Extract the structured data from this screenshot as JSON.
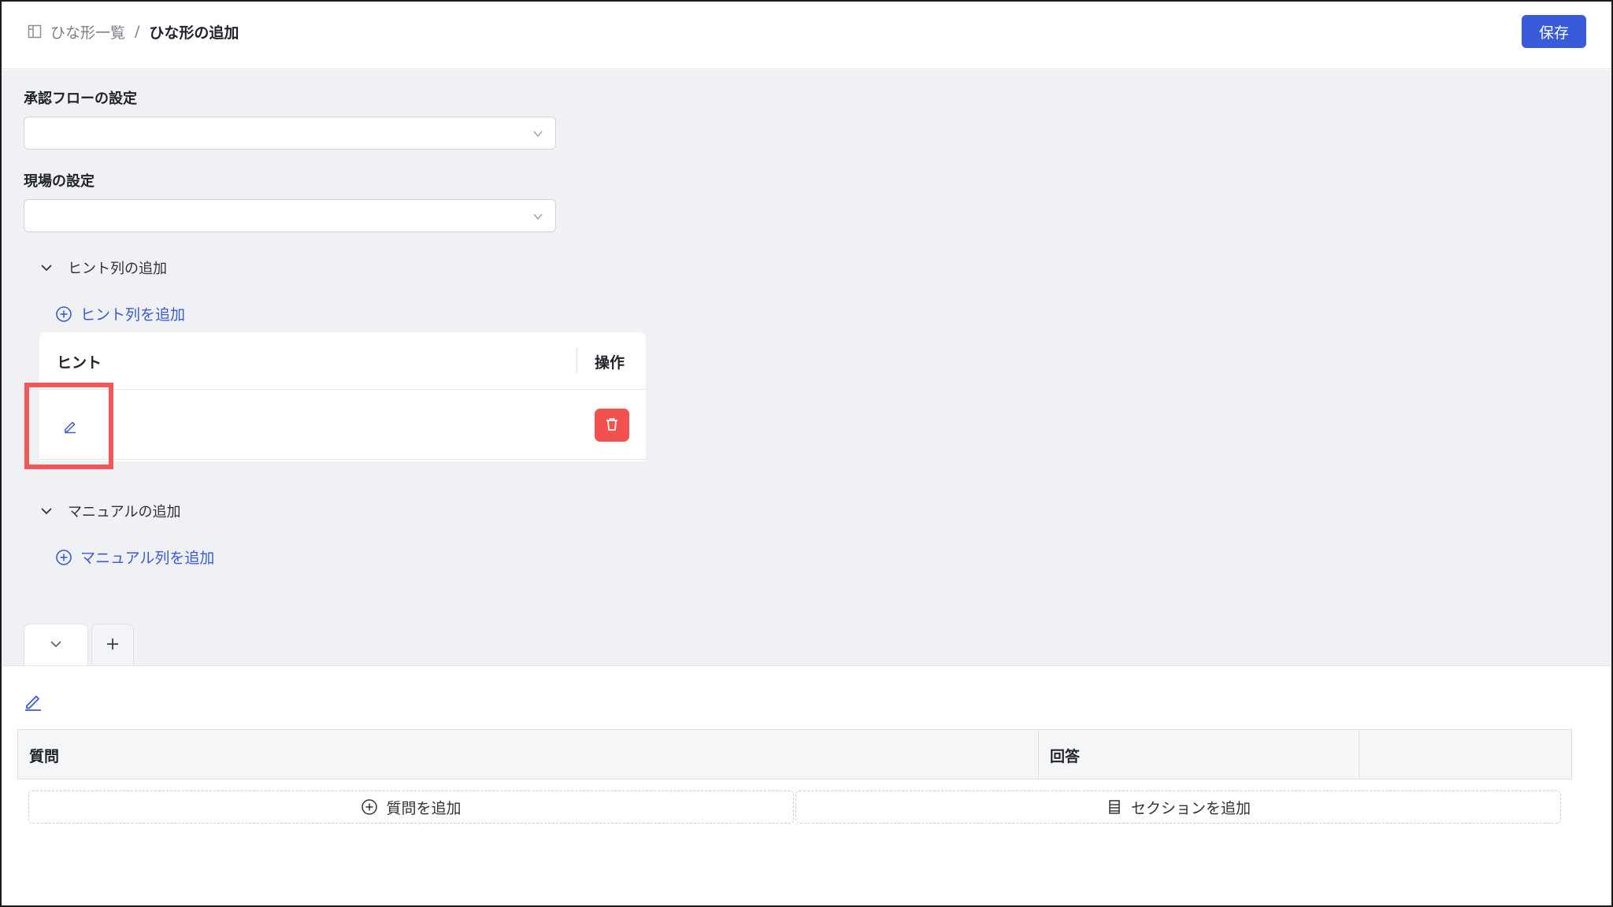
{
  "header": {
    "breadcrumb_parent": "ひな形一覧",
    "breadcrumb_separator": "/",
    "breadcrumb_current": "ひな形の追加",
    "save_label": "保存"
  },
  "form": {
    "approval_flow_label": "承認フローの設定",
    "approval_flow_value": "",
    "site_label": "現場の設定",
    "site_value": ""
  },
  "hints": {
    "section_title": "ヒント列の追加",
    "add_link": "ヒント列を追加",
    "col_hint": "ヒント",
    "col_ops": "操作"
  },
  "manual": {
    "section_title": "マニュアルの追加",
    "add_link": "マニュアル列を追加"
  },
  "qa": {
    "col_question": "質問",
    "col_answer": "回答",
    "add_question": "質問を追加",
    "add_section": "セクションを追加"
  },
  "colors": {
    "primary": "#3a5bd9",
    "danger": "#f35050",
    "highlight": "#f0585a",
    "background": "#f0f1f5"
  }
}
